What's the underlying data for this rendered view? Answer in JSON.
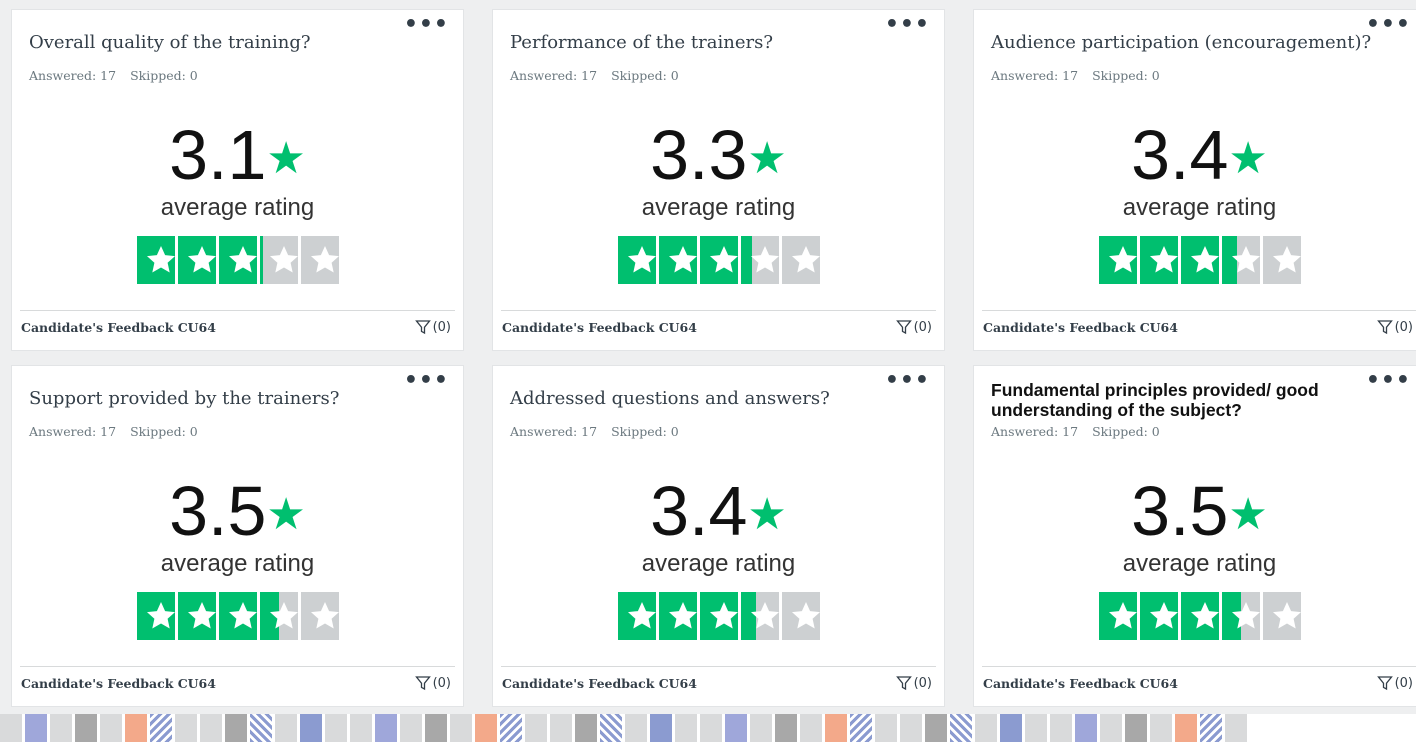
{
  "cards": [
    {
      "title": "Overall quality of the training?",
      "answered": "Answered: 17",
      "skipped": "Skipped: 0",
      "rating": "3.1",
      "rating_value": 3.1,
      "avg_label": "average rating",
      "footer": "Candidate's Feedback CU64",
      "filter": "(0)"
    },
    {
      "title": "Performance of the trainers?",
      "answered": "Answered: 17",
      "skipped": "Skipped: 0",
      "rating": "3.3",
      "rating_value": 3.3,
      "avg_label": "average rating",
      "footer": "Candidate's Feedback CU64",
      "filter": "(0)"
    },
    {
      "title": "Audience participation (encouragement)?",
      "answered": "Answered: 17",
      "skipped": "Skipped: 0",
      "rating": "3.4",
      "rating_value": 3.4,
      "avg_label": "average rating",
      "footer": "Candidate's Feedback CU64",
      "filter": "(0)"
    },
    {
      "title": "Support provided by the trainers?",
      "answered": "Answered: 17",
      "skipped": "Skipped: 0",
      "rating": "3.5",
      "rating_value": 3.5,
      "avg_label": "average rating",
      "footer": "Candidate's Feedback CU64",
      "filter": "(0)"
    },
    {
      "title": "Addressed questions and answers?",
      "answered": "Answered: 17",
      "skipped": "Skipped: 0",
      "rating": "3.4",
      "rating_value": 3.4,
      "avg_label": "average rating",
      "footer": "Candidate's Feedback CU64",
      "filter": "(0)"
    },
    {
      "title": "Fundamental principles provided/ good understanding of the subject?",
      "answered": "Answered: 17",
      "skipped": "Skipped: 0",
      "rating": "3.5",
      "rating_value": 3.5,
      "avg_label": "average rating",
      "footer": "Candidate's Feedback CU64",
      "filter": "(0)"
    }
  ],
  "colors": {
    "accent": "#00bf6f",
    "empty_star": "#cdd0d2"
  },
  "icons": {
    "menu": "more-horizontal-icon",
    "filter": "filter-funnel-icon",
    "star": "star-icon"
  }
}
